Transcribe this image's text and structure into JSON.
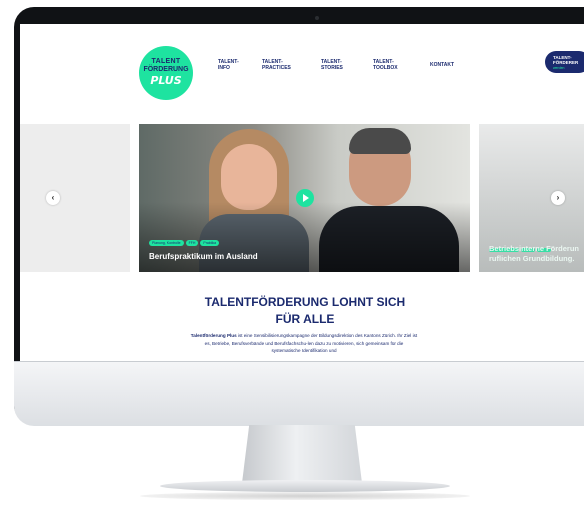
{
  "brand": {
    "logo_line1": "TALENT",
    "logo_line2": "FÖRDERUNG",
    "logo_line3": "PLUS"
  },
  "nav": {
    "items": [
      {
        "label": "TALENT-\nINFO"
      },
      {
        "label": "TALENT-\nPRACTICES"
      },
      {
        "label": "TALENT-\nSTORIES"
      },
      {
        "label": "TALENT-\nTOOLBOX"
      },
      {
        "label": "KONTAKT"
      }
    ]
  },
  "partner": {
    "line1": "TALENT-\nFÖRDERER",
    "line2": "werden"
  },
  "slider": {
    "main": {
      "tags": [
        "Planung, Kontrolle",
        "FFH",
        "Praktika"
      ],
      "title": "Berufspraktikum im Ausland"
    },
    "right": {
      "title": "Betriebsinterne Förderun\nruflichen Grundbildung."
    },
    "prev_icon": "chevron-left-icon",
    "next_icon": "chevron-right-icon",
    "play_icon": "play-icon"
  },
  "content": {
    "headline_line1": "TALENTFÖRDERUNG LOHNT SICH",
    "headline_line2": "FÜR ALLE",
    "intro_bold": "Talentförderung Plus",
    "intro_rest": " ist eine Sensibilisierungskampagne der Bildungsdirektion des Kantons Zürich. Ihr Ziel ist es, Betriebe, Berufsverbände und Berufsfachschu-len dazu zu motivieren, sich gemeinsam für die systematische Identifikation und"
  },
  "colors": {
    "accent": "#1ee3a0",
    "navy": "#1b2a6e"
  }
}
